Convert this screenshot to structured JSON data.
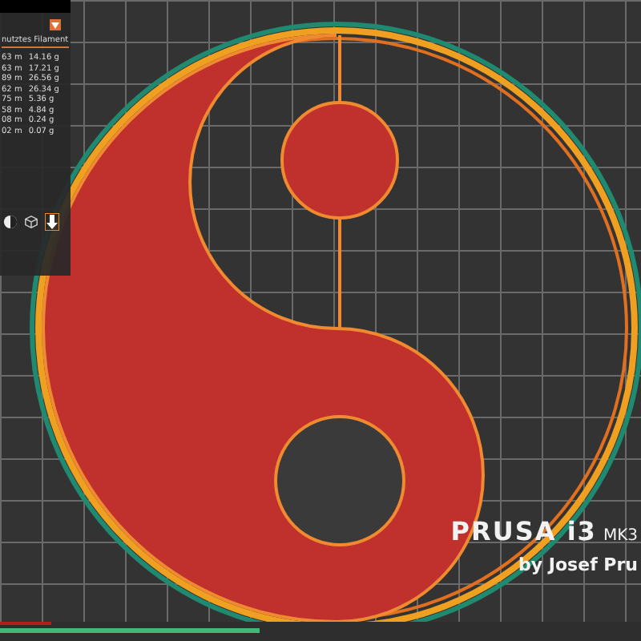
{
  "stats_panel": {
    "header": "nutztes Filament",
    "rows": [
      {
        "length": "63 m",
        "weight": "14.16 g"
      },
      {
        "length": "63 m",
        "weight": "17.21 g"
      },
      {
        "length": "89 m",
        "weight": "26.56 g"
      },
      {
        "length": "62 m",
        "weight": "26.34 g"
      },
      {
        "length": "75 m",
        "weight": "5.36 g"
      },
      {
        "length": "58 m",
        "weight": "4.84 g"
      },
      {
        "length": "08 m",
        "weight": "0.24 g"
      },
      {
        "length": "02 m",
        "weight": "0.07 g"
      }
    ]
  },
  "bed_label": {
    "title": "PRUSA i3",
    "model": "MK3",
    "author": "by Josef Pru"
  },
  "layer_slider": {
    "level": 0.405
  }
}
